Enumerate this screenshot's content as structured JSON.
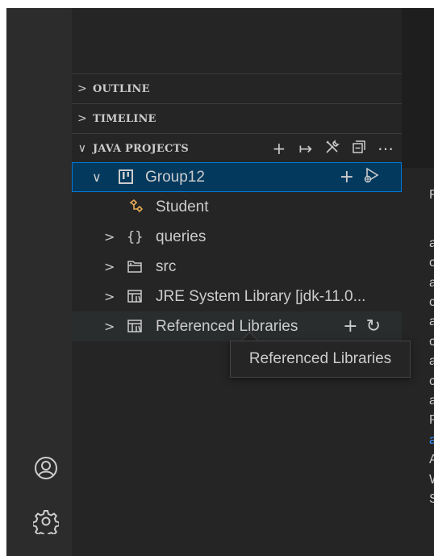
{
  "sections": {
    "outline": {
      "chevron": ">",
      "title": "OUTLINE"
    },
    "timeline": {
      "chevron": ">",
      "title": "TIMELINE"
    },
    "java_projects": {
      "chevron": "∨",
      "title": "JAVA PROJECTS",
      "actions": [
        "+",
        "↦",
        "build-tools-icon",
        "collapse-all-icon",
        "⋯"
      ]
    }
  },
  "tree": {
    "project": {
      "chevron": "∨",
      "icon": "project-icon",
      "label": "Group12",
      "actions": [
        "+",
        "run-debug-icon"
      ]
    },
    "student": {
      "icon": "class-icon",
      "label": "Student",
      "icon_color": "#e8ab53"
    },
    "queries": {
      "chevron": ">",
      "icon": "{}",
      "label": "queries"
    },
    "src": {
      "chevron": ">",
      "icon": "folder-icon",
      "label": "src"
    },
    "jre": {
      "chevron": ">",
      "icon": "library-icon",
      "label": "JRE System Library [jdk-11.0..."
    },
    "referenced": {
      "chevron": ">",
      "icon": "library-icon",
      "label": "Referenced Libraries",
      "actions": [
        "+",
        "↻"
      ]
    }
  },
  "tooltip": {
    "text": "Referenced Libraries"
  },
  "activity_bar": {
    "icons": [
      "account-icon",
      "settings-gear-icon"
    ]
  },
  "editor_panel": {
    "lines": [
      "F",
      "a",
      "c",
      "a",
      "c",
      "a",
      "c",
      "a",
      "c",
      "a",
      "P",
      "a",
      "A",
      "W",
      "S"
    ]
  },
  "colors": {
    "sidebar_bg": "#252526",
    "activity_bg": "#2c2c2c",
    "selection_bg": "#04395e",
    "selection_border": "#0078d4",
    "link": "#3794ff"
  }
}
